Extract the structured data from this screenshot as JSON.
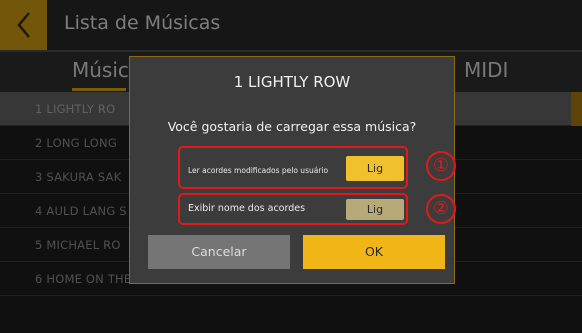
{
  "header": {
    "title": "Lista de Músicas",
    "back_icon": "chevron-left-icon"
  },
  "tabs": [
    {
      "label": "Músic",
      "active": true
    },
    {
      "label": "MIDI",
      "active": false
    }
  ],
  "songs": [
    {
      "label": "1 LIGHTLY RO",
      "selected": true
    },
    {
      "label": "2 LONG LONG",
      "selected": false
    },
    {
      "label": "3 SAKURA SAK",
      "selected": false
    },
    {
      "label": "4 AULD LANG S",
      "selected": false
    },
    {
      "label": "5 MICHAEL RO",
      "selected": false
    },
    {
      "label": "6 HOME ON THE RANGE",
      "selected": false
    }
  ],
  "dialog": {
    "title": "1 LIGHTLY ROW",
    "question": "Você gostaria de carregar essa música?",
    "options": [
      {
        "label": "Ler acordes modificados pelo usuário",
        "toggle_label": "Lig",
        "marker": "①"
      },
      {
        "label": "Exibir nome dos acordes",
        "toggle_label": "Lig",
        "marker": "②"
      }
    ],
    "cancel_label": "Cancelar",
    "ok_label": "OK"
  },
  "colors": {
    "accent": "#d39e12",
    "ok_button": "#f1b518",
    "toggle_on": "#f1c12d",
    "annotation_red": "#e01a1a"
  }
}
